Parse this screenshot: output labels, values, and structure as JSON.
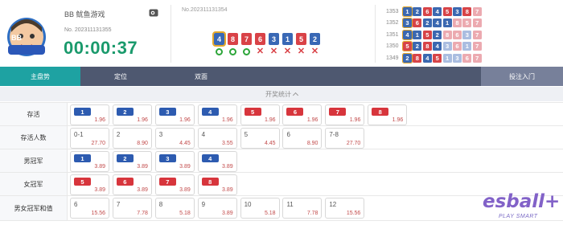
{
  "header": {
    "game_name": "BB 鱿鱼游戏",
    "round_label": "No. 202311131355",
    "timer": "00:00:37",
    "current_round": "No.202311131354",
    "current_balls": [
      {
        "num": "4",
        "color": "blue",
        "selected": true
      },
      {
        "num": "8",
        "color": "red",
        "selected": false
      },
      {
        "num": "7",
        "color": "red",
        "selected": false
      },
      {
        "num": "6",
        "color": "red",
        "selected": false
      },
      {
        "num": "3",
        "color": "blue",
        "selected": false
      },
      {
        "num": "1",
        "color": "blue",
        "selected": false
      },
      {
        "num": "5",
        "color": "red",
        "selected": false
      },
      {
        "num": "2",
        "color": "blue",
        "selected": false
      }
    ],
    "current_marks": [
      "ok",
      "ok",
      "ok",
      "no",
      "no",
      "no",
      "no",
      "no"
    ]
  },
  "history": [
    {
      "round": "1353",
      "balls": [
        [
          "1",
          "hblue",
          true
        ],
        [
          "2",
          "hblue",
          false
        ],
        [
          "6",
          "hred",
          false
        ],
        [
          "4",
          "hblue",
          false
        ],
        [
          "5",
          "hred",
          false
        ],
        [
          "3",
          "hblue",
          false
        ],
        [
          "8",
          "hred",
          false
        ],
        [
          "7",
          "hlred",
          false
        ]
      ]
    },
    {
      "round": "1352",
      "balls": [
        [
          "3",
          "hblue",
          true
        ],
        [
          "6",
          "hred",
          false
        ],
        [
          "2",
          "hblue",
          false
        ],
        [
          "4",
          "hblue",
          false
        ],
        [
          "1",
          "hblue",
          false
        ],
        [
          "8",
          "hlred",
          false
        ],
        [
          "5",
          "hlred",
          false
        ],
        [
          "7",
          "hlred",
          false
        ]
      ]
    },
    {
      "round": "1351",
      "balls": [
        [
          "4",
          "hblue",
          true
        ],
        [
          "1",
          "hblue",
          false
        ],
        [
          "5",
          "hred",
          false
        ],
        [
          "2",
          "hblue",
          false
        ],
        [
          "8",
          "hlred",
          false
        ],
        [
          "6",
          "hlred",
          false
        ],
        [
          "3",
          "hlblue",
          false
        ],
        [
          "7",
          "hlred",
          false
        ]
      ]
    },
    {
      "round": "1350",
      "balls": [
        [
          "5",
          "hred",
          true
        ],
        [
          "2",
          "hblue",
          false
        ],
        [
          "8",
          "hred",
          false
        ],
        [
          "4",
          "hblue",
          false
        ],
        [
          "3",
          "hlblue",
          false
        ],
        [
          "6",
          "hlred",
          false
        ],
        [
          "1",
          "hlblue",
          false
        ],
        [
          "7",
          "hlred",
          false
        ]
      ]
    },
    {
      "round": "1349",
      "balls": [
        [
          "2",
          "hblue",
          true
        ],
        [
          "8",
          "hred",
          false
        ],
        [
          "4",
          "hblue",
          false
        ],
        [
          "5",
          "hred",
          false
        ],
        [
          "1",
          "hlblue",
          false
        ],
        [
          "3",
          "hlblue",
          false
        ],
        [
          "6",
          "hlred",
          false
        ],
        [
          "7",
          "hlred",
          false
        ]
      ]
    }
  ],
  "tabs": [
    "主盘势",
    "定位",
    "双面",
    "投注入门"
  ],
  "stats_label": "开奖统计",
  "rows": [
    {
      "label": "存活",
      "cells": [
        {
          "chip": "1",
          "color": "blue",
          "odds": "1.96"
        },
        {
          "chip": "2",
          "color": "blue",
          "odds": "1.96"
        },
        {
          "chip": "3",
          "color": "blue",
          "odds": "1.96"
        },
        {
          "chip": "4",
          "color": "blue",
          "odds": "1.96"
        },
        {
          "chip": "5",
          "color": "red",
          "odds": "1.96"
        },
        {
          "chip": "6",
          "color": "red",
          "odds": "1.96"
        },
        {
          "chip": "7",
          "color": "red",
          "odds": "1.96"
        },
        {
          "chip": "8",
          "color": "red",
          "odds": "1.96"
        }
      ]
    },
    {
      "label": "存活人数",
      "cells": [
        {
          "text": "0-1",
          "odds": "27.70"
        },
        {
          "text": "2",
          "odds": "8.90"
        },
        {
          "text": "3",
          "odds": "4.45"
        },
        {
          "text": "4",
          "odds": "3.55"
        },
        {
          "text": "5",
          "odds": "4.45"
        },
        {
          "text": "6",
          "odds": "8.90"
        },
        {
          "text": "7-8",
          "odds": "27.70"
        }
      ]
    },
    {
      "label": "男冠军",
      "cells": [
        {
          "chip": "1",
          "color": "blue",
          "odds": "3.89"
        },
        {
          "chip": "2",
          "color": "blue",
          "odds": "3.89"
        },
        {
          "chip": "3",
          "color": "blue",
          "odds": "3.89"
        },
        {
          "chip": "4",
          "color": "blue",
          "odds": "3.89"
        }
      ]
    },
    {
      "label": "女冠军",
      "cells": [
        {
          "chip": "5",
          "color": "red",
          "odds": "3.89"
        },
        {
          "chip": "6",
          "color": "red",
          "odds": "3.89"
        },
        {
          "chip": "7",
          "color": "red",
          "odds": "3.89"
        },
        {
          "chip": "8",
          "color": "red",
          "odds": "3.89"
        }
      ]
    },
    {
      "label": "男女冠军和值",
      "cells": [
        {
          "text": "6",
          "odds": "15.56"
        },
        {
          "text": "7",
          "odds": "7.78"
        },
        {
          "text": "8",
          "odds": "5.18"
        },
        {
          "text": "9",
          "odds": "3.89"
        },
        {
          "text": "10",
          "odds": "5.18"
        },
        {
          "text": "11",
          "odds": "7.78"
        },
        {
          "text": "12",
          "odds": "15.56"
        }
      ]
    }
  ],
  "brand": {
    "name": "esball+",
    "slogan": "PLAY SMART"
  },
  "colors": {
    "teal": "#1ea2a2",
    "timer": "#1a9a6c",
    "blue": "#2d5bb0",
    "red": "#d7353c",
    "navy": "#4e5870"
  }
}
